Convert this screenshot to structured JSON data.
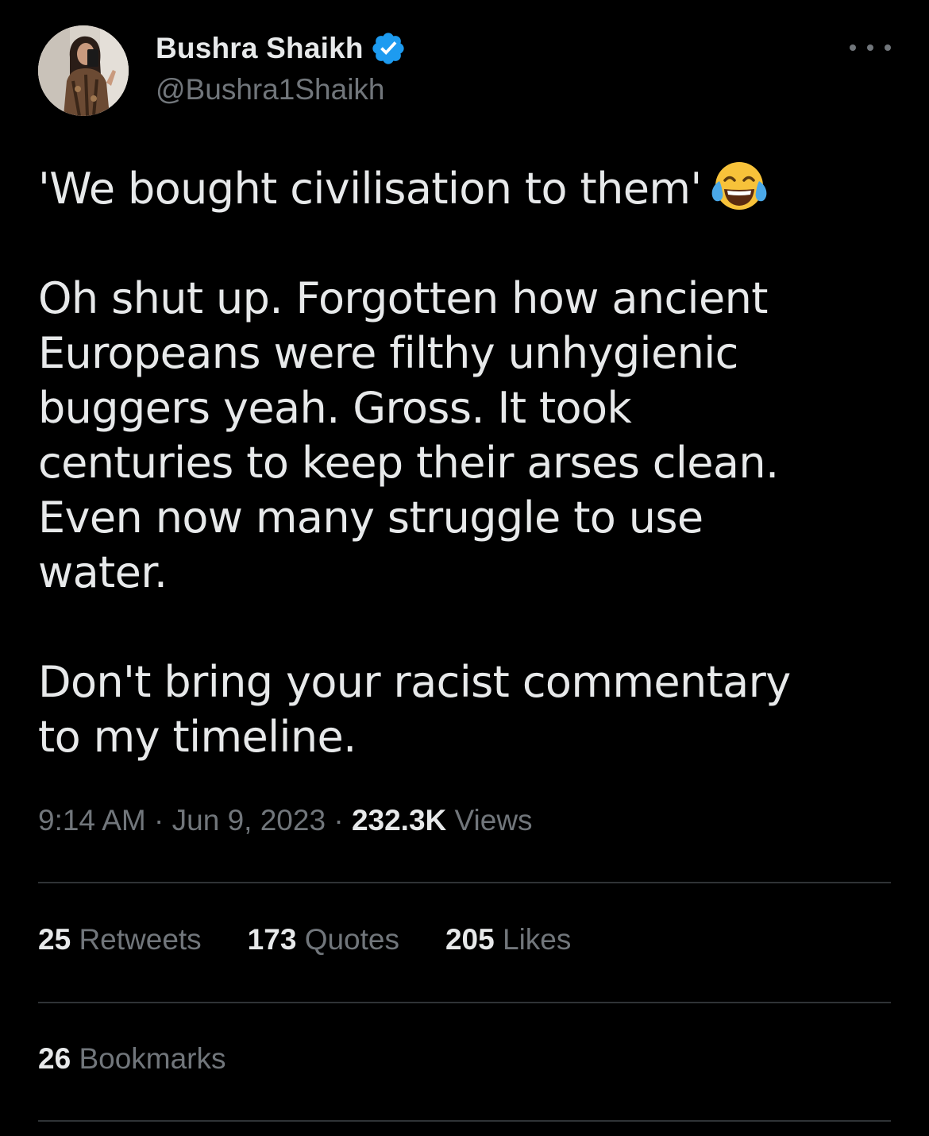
{
  "author": {
    "display_name": "Bushra Shaikh",
    "handle": "@Bushra1Shaikh",
    "verified": true,
    "verified_color": "#1d9bf0",
    "avatar_icon": "user-photo-avatar"
  },
  "menu": {
    "icon": "more-horizontal-icon"
  },
  "tweet": {
    "lines": [
      "'We bought civilisation to them'",
      "Oh shut up. Forgotten how ancient",
      "Europeans were filthy unhygienic",
      "buggers yeah. Gross. It took",
      "centuries to keep their arses clean.",
      "Even now many struggle to use",
      "water.",
      "Don't bring your racist commentary",
      "to my timeline."
    ],
    "emoji": "face-with-tears-of-joy-emoji"
  },
  "meta": {
    "time": "9:14 AM",
    "separator": "·",
    "date": "Jun 9, 2023",
    "views_count": "232.3K",
    "views_label": "Views"
  },
  "stats": {
    "retweets_count": "25",
    "retweets_label": "Retweets",
    "quotes_count": "173",
    "quotes_label": "Quotes",
    "likes_count": "205",
    "likes_label": "Likes",
    "bookmarks_count": "26",
    "bookmarks_label": "Bookmarks"
  },
  "colors": {
    "background": "#000000",
    "primary_text": "#e7e9ea",
    "secondary_text": "#71767b",
    "divider": "#2f3336"
  }
}
